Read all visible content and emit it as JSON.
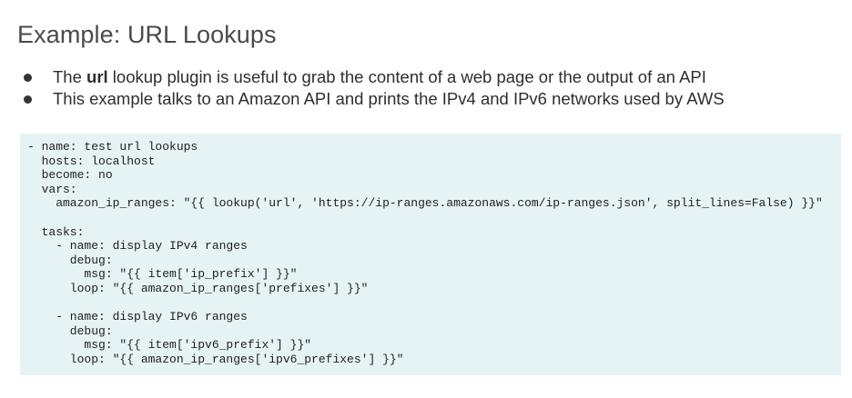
{
  "title": "Example: URL Lookups",
  "bullets": [
    {
      "before": "The ",
      "bold": "url",
      "after": " lookup plugin is useful to grab the content of a web page or the output of an API"
    },
    {
      "before": "This example talks to an Amazon API and prints the IPv4 and IPv6 networks used by AWS",
      "bold": "",
      "after": ""
    }
  ],
  "code_lines": [
    "- name: test url lookups",
    "  hosts: localhost",
    "  become: no",
    "  vars:",
    "    amazon_ip_ranges: \"{{ lookup('url', 'https://ip-ranges.amazonaws.com/ip-ranges.json', split_lines=False) }}\"",
    "",
    "  tasks:",
    "    - name: display IPv4 ranges",
    "      debug:",
    "        msg: \"{{ item['ip_prefix'] }}\"",
    "      loop: \"{{ amazon_ip_ranges['prefixes'] }}\"",
    "",
    "    - name: display IPv6 ranges",
    "      debug:",
    "        msg: \"{{ item['ipv6_prefix'] }}\"",
    "      loop: \"{{ amazon_ip_ranges['ipv6_prefixes'] }}\""
  ],
  "colors": {
    "code_background": "#e6f3f5",
    "title_text": "#4a4a4a"
  }
}
